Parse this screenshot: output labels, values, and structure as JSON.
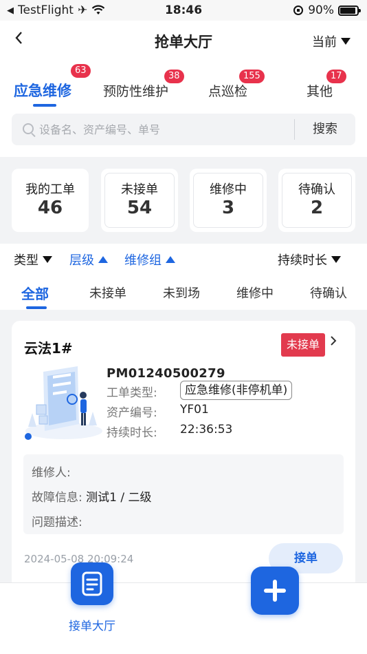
{
  "status_bar": {
    "back_app": "TestFlight",
    "time": "18:46",
    "battery": "90%"
  },
  "nav": {
    "back_icon": "chevron-left-icon",
    "title": "抢单大厅",
    "current_label": "当前"
  },
  "top_tabs": [
    {
      "label": "应急维修",
      "badge": "63",
      "active": true
    },
    {
      "label": "预防性维护",
      "badge": "38",
      "active": false
    },
    {
      "label": "点巡检",
      "badge": "155",
      "active": false
    },
    {
      "label": "其他",
      "badge": "17",
      "active": false
    }
  ],
  "search": {
    "value": "",
    "placeholder": "设备名、资产编号、单号",
    "button_label": "搜索"
  },
  "stats": [
    {
      "label": "我的工单",
      "value": "46"
    },
    {
      "label": "未接单",
      "value": "54"
    },
    {
      "label": "维修中",
      "value": "3"
    },
    {
      "label": "待确认",
      "value": "2"
    }
  ],
  "filters": [
    {
      "label": "类型",
      "direction": "down"
    },
    {
      "label": "层级",
      "direction": "up"
    },
    {
      "label": "维修组",
      "direction": "up"
    },
    {
      "label": "持续时长",
      "direction": "down"
    }
  ],
  "status_tabs": [
    {
      "label": "全部",
      "active": true
    },
    {
      "label": "未接单",
      "active": false
    },
    {
      "label": "未到场",
      "active": false
    },
    {
      "label": "维修中",
      "active": false
    },
    {
      "label": "待确认",
      "active": false
    }
  ],
  "order_card": {
    "title": "云法1#",
    "status": "未接单",
    "order_id": "PM01240500279",
    "type_label": "工单类型:",
    "type_value": "应急维修(非停机单)",
    "asset_label": "资产编号:",
    "asset_value": "YF01",
    "duration_label": "持续时长:",
    "duration_value": "22:36:53",
    "repairer_label": "维修人:",
    "repairer_value": "",
    "fault_label": "故障信息:",
    "fault_value": "测试1 / 二级",
    "problem_label": "问题描述:",
    "problem_value": "",
    "created_time": "2024-05-08 20:09:24",
    "accept_label": "接单"
  },
  "bottom_bar": {
    "hall_label": "接单大厅",
    "hall_icon": "document-icon",
    "add_icon": "plus-icon"
  },
  "colors": {
    "primary": "#1e66e0",
    "badge": "#e8324c",
    "status_red": "#e23a4e",
    "background": "#f2f3f5"
  }
}
